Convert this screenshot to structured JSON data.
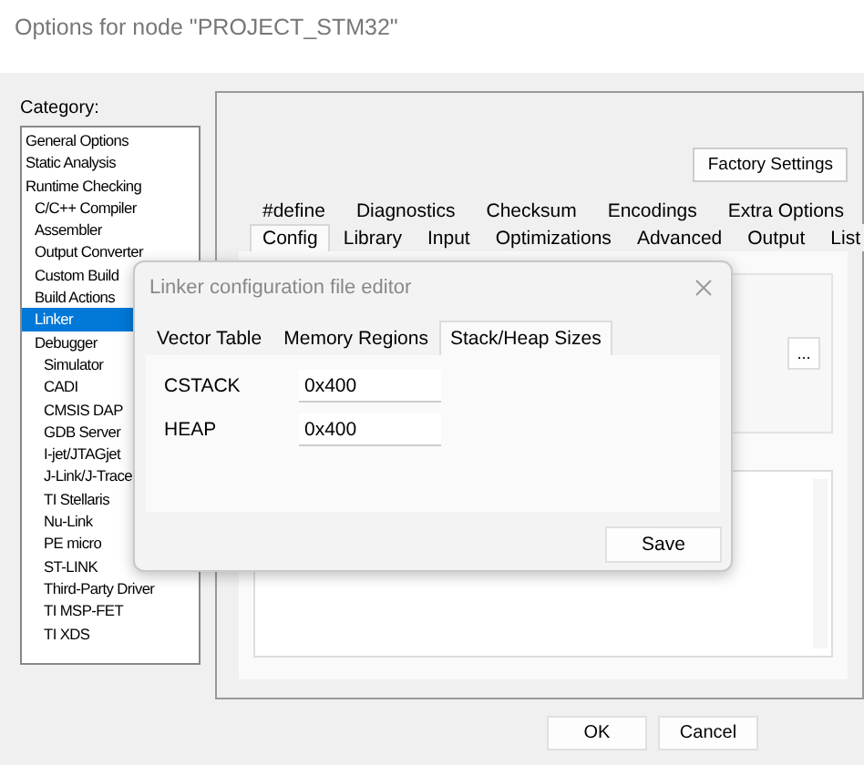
{
  "window": {
    "title": "Options for node \"PROJECT_STM32\""
  },
  "category": {
    "label": "Category:",
    "items": [
      {
        "label": "General Options",
        "selected": false
      },
      {
        "label": "Static Analysis",
        "selected": false
      },
      {
        "label": "Runtime Checking",
        "selected": false,
        "children": [
          {
            "label": "C/C++ Compiler",
            "selected": false
          },
          {
            "label": "Assembler",
            "selected": false
          },
          {
            "label": "Output Converter",
            "selected": false
          },
          {
            "label": "Custom Build",
            "selected": false
          },
          {
            "label": "Build Actions",
            "selected": false
          },
          {
            "label": "Linker",
            "selected": true
          },
          {
            "label": "Debugger",
            "selected": false,
            "children": [
              {
                "label": "Simulator",
                "selected": false
              },
              {
                "label": "CADI",
                "selected": false
              },
              {
                "label": "CMSIS DAP",
                "selected": false
              },
              {
                "label": "GDB Server",
                "selected": false
              },
              {
                "label": "I-jet/JTAGjet",
                "selected": false
              },
              {
                "label": "J-Link/J-Trace",
                "selected": false
              },
              {
                "label": "TI Stellaris",
                "selected": false
              },
              {
                "label": "Nu-Link",
                "selected": false
              },
              {
                "label": "PE micro",
                "selected": false
              },
              {
                "label": "ST-LINK",
                "selected": false
              },
              {
                "label": "Third-Party Driver",
                "selected": false
              },
              {
                "label": "TI MSP-FET",
                "selected": false
              },
              {
                "label": "TI XDS",
                "selected": false
              }
            ]
          }
        ]
      }
    ]
  },
  "factory_settings_button": "Factory Settings",
  "tabs_row_1": [
    {
      "label": "#define",
      "selected": false
    },
    {
      "label": "Diagnostics",
      "selected": false
    },
    {
      "label": "Checksum",
      "selected": false
    },
    {
      "label": "Encodings",
      "selected": false
    },
    {
      "label": "Extra Options",
      "selected": false
    }
  ],
  "tabs_row_2": [
    {
      "label": "Config",
      "selected": true
    },
    {
      "label": "Library",
      "selected": false
    },
    {
      "label": "Input",
      "selected": false
    },
    {
      "label": "Optimizations",
      "selected": false
    },
    {
      "label": "Advanced",
      "selected": false
    },
    {
      "label": "Output",
      "selected": false
    },
    {
      "label": "List",
      "selected": false
    }
  ],
  "browse_button": "...",
  "editor": {
    "title": "Linker configuration file editor",
    "tabs": [
      {
        "label": "Vector Table",
        "selected": false
      },
      {
        "label": "Memory Regions",
        "selected": false
      },
      {
        "label": "Stack/Heap Sizes",
        "selected": true
      }
    ],
    "fields": [
      {
        "label": "CSTACK",
        "value": "0x400"
      },
      {
        "label": "HEAP",
        "value": "0x400"
      }
    ],
    "save_button": "Save"
  },
  "buttons": [
    "OK",
    "Cancel"
  ]
}
